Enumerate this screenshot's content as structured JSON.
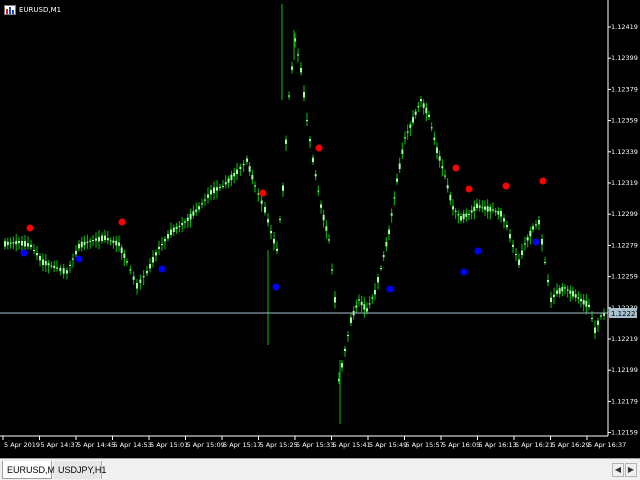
{
  "chart": {
    "symbol_title": "EURUSD,M1",
    "icon": "chart-window-icon",
    "price_labels": [
      "1.12419",
      "1.12399",
      "1.12379",
      "1.12359",
      "1.12339",
      "1.12319",
      "1.12299",
      "1.12279",
      "1.12259",
      "1.12239",
      "1.12219",
      "1.12199",
      "1.12179",
      "1.12159"
    ],
    "current_price_label": "1.12227",
    "time_labels": [
      "5 Apr 2019",
      "5 Apr 14:37",
      "5 Apr 14:45",
      "5 Apr 14:53",
      "5 Apr 15:01",
      "5 Apr 15:09",
      "5 Apr 15:17",
      "5 Apr 15:25",
      "5 Apr 15:33",
      "5 Apr 15:41",
      "5 Apr 15:49",
      "5 Apr 15:57",
      "5 Apr 16:05",
      "5 Apr 16:13",
      "5 Apr 16:21",
      "5 Apr 16:29",
      "5 Apr 16:37"
    ],
    "colors": {
      "background": "#000000",
      "bull_candle": "#9cff9c",
      "wick": "#00c800",
      "bid_line": "#a8bfd0",
      "signal_sell": "#ff0000",
      "signal_buy": "#0000ff",
      "axis_text": "#ffffff"
    }
  },
  "tabs": [
    {
      "label": "EURUSD,M1",
      "active": true
    },
    {
      "label": "USDJPY,H1",
      "active": false
    }
  ],
  "tab_nav": {
    "prev_icon": "chevron-left-icon",
    "next_icon": "chevron-right-icon"
  }
}
